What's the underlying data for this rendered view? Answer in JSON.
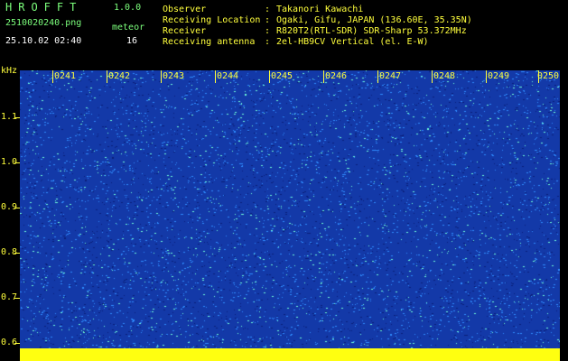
{
  "header": {
    "app_title": "HROFFT",
    "version": "1.0.0",
    "filename": "2510020240.png",
    "datetime": "25.10.02 02:40",
    "detection_label": "meteor",
    "detection_count": "16"
  },
  "metadata": [
    {
      "key": "Observer",
      "sep": ":",
      "value": "Takanori Kawachi"
    },
    {
      "key": "Receiving Location",
      "sep": ":",
      "value": "Ogaki, Gifu, JAPAN (136.60E, 35.35N)"
    },
    {
      "key": "Receiver",
      "sep": ":",
      "value": "R820T2(RTL-SDR) SDR-Sharp 53.372MHz"
    },
    {
      "key": "Receiving antenna",
      "sep": ":",
      "value": "2el-HB9CV Vertical (el. E-W)"
    }
  ],
  "spectrogram": {
    "y_unit": "kHz",
    "y_ticks": [
      "1.1",
      "1.0",
      "0.9",
      "0.8",
      "0.7",
      "0.6"
    ],
    "x_ticks": [
      "0241",
      "0242",
      "0243",
      "0244",
      "0245",
      "0246",
      "0247",
      "0248",
      "0249",
      "0250"
    ],
    "colors": {
      "background": "#1339a8",
      "noise_low": "#0a1f7a",
      "noise_mid": "#2f8cff",
      "noise_high": "#6fffd8",
      "baseline": "#ffff10"
    }
  }
}
